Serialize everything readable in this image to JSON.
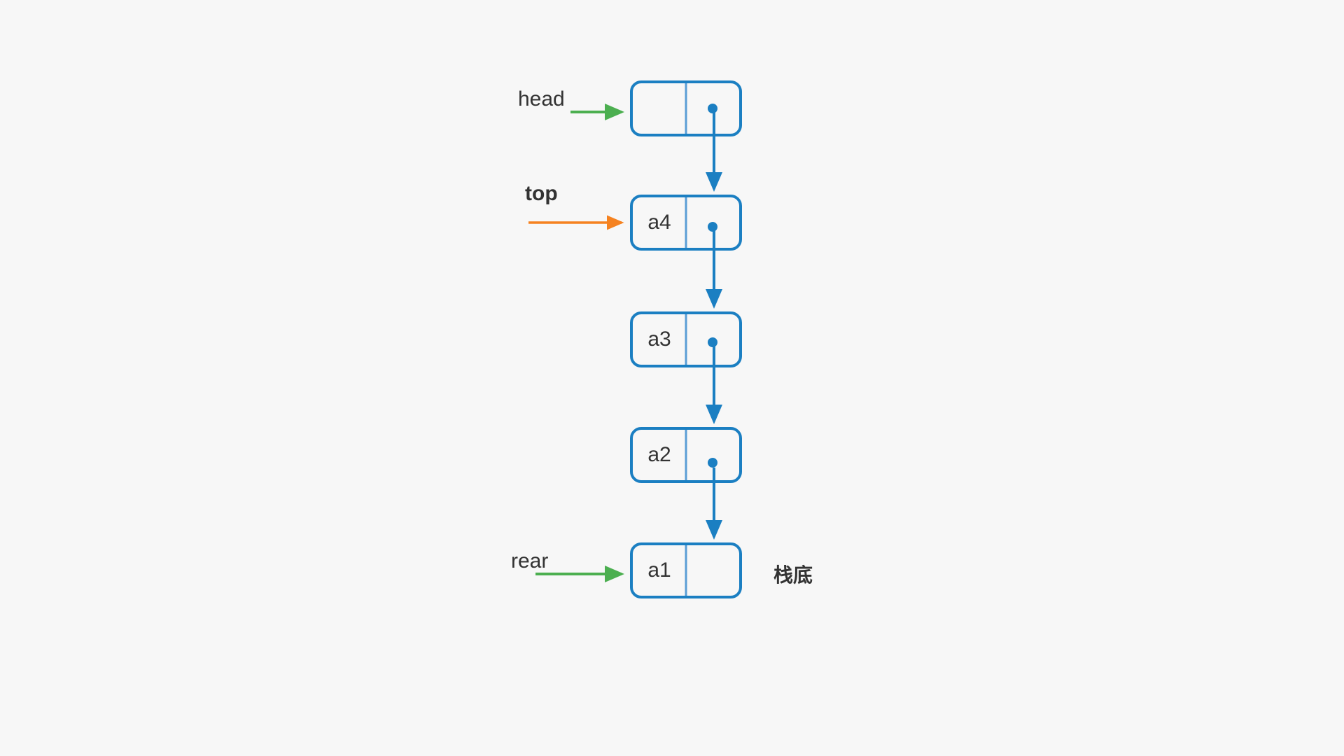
{
  "diagram": {
    "labels": {
      "head": "head",
      "top": "top",
      "rear": "rear",
      "bottom_annotation": "栈底"
    },
    "nodes": [
      {
        "id": "head",
        "data": "",
        "has_pointer": true
      },
      {
        "id": "n4",
        "data": "a4",
        "has_pointer": true
      },
      {
        "id": "n3",
        "data": "a3",
        "has_pointer": true
      },
      {
        "id": "n2",
        "data": "a2",
        "has_pointer": true
      },
      {
        "id": "n1",
        "data": "a1",
        "has_pointer": false
      }
    ],
    "colors": {
      "node_border": "#1b7fc2",
      "arrow_blue": "#1b7fc2",
      "arrow_green": "#4caf50",
      "arrow_orange": "#f58220",
      "bg": "#f7f7f7"
    }
  },
  "chart_data": {
    "type": "diagram",
    "description": "Linked-list stack. 'head' points to a header node (empty data + next pointer). 'top' marks the top of the stack at node a4. Nodes link a4 → a3 → a2 → a1. 'rear' points to a1, annotated as 栈底 (stack bottom). Node a1 has no outgoing pointer.",
    "nodes": [
      "head(empty)",
      "a4",
      "a3",
      "a2",
      "a1"
    ],
    "edges": [
      [
        "head_node",
        "a4"
      ],
      [
        "a4",
        "a3"
      ],
      [
        "a3",
        "a2"
      ],
      [
        "a2",
        "a1"
      ]
    ],
    "pointers": {
      "head": "head_node",
      "top": "a4",
      "rear": "a1"
    },
    "annotations": {
      "a1": "栈底"
    }
  }
}
